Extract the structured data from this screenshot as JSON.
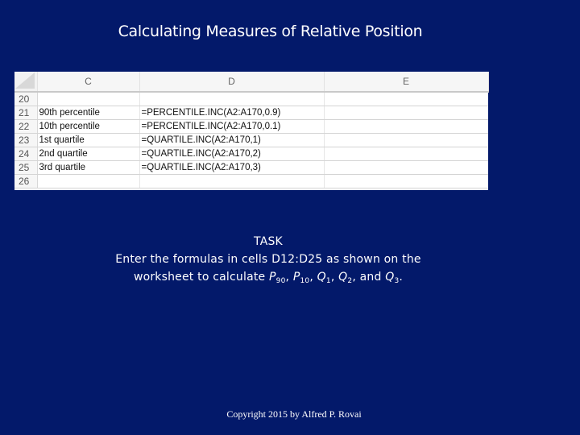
{
  "slide": {
    "title": "Calculating Measures of Relative Position",
    "background_color": "#03196a",
    "text_color": "#ffffff"
  },
  "spreadsheet": {
    "columns": [
      "C",
      "D",
      "E"
    ],
    "rows": [
      {
        "row": "20",
        "C": "",
        "D": "",
        "E": ""
      },
      {
        "row": "21",
        "C": "90th percentile",
        "D": "=PERCENTILE.INC(A2:A170,0.9)",
        "E": ""
      },
      {
        "row": "22",
        "C": "10th percentile",
        "D": "=PERCENTILE.INC(A2:A170,0.1)",
        "E": ""
      },
      {
        "row": "23",
        "C": "1st quartile",
        "D": "=QUARTILE.INC(A2:A170,1)",
        "E": ""
      },
      {
        "row": "24",
        "C": "2nd quartile",
        "D": "=QUARTILE.INC(A2:A170,2)",
        "E": ""
      },
      {
        "row": "25",
        "C": "3rd quartile",
        "D": "=QUARTILE.INC(A2:A170,3)",
        "E": ""
      },
      {
        "row": "26",
        "C": "",
        "D": "",
        "E": ""
      }
    ]
  },
  "task": {
    "heading": "TASK",
    "line1": "Enter the formulas in cells D12:D25 as shown on the",
    "line2_prefix": "worksheet to calculate ",
    "symbols": [
      {
        "base": "P",
        "sub": "90",
        "sep": ", "
      },
      {
        "base": "P",
        "sub": "10",
        "sep": ", "
      },
      {
        "base": "Q",
        "sub": "1",
        "sep": ", "
      },
      {
        "base": "Q",
        "sub": "2",
        "sep": ", and "
      },
      {
        "base": "Q",
        "sub": "3",
        "sep": "."
      }
    ]
  },
  "footer": {
    "copyright": "Copyright 2015 by Alfred P. Rovai"
  }
}
